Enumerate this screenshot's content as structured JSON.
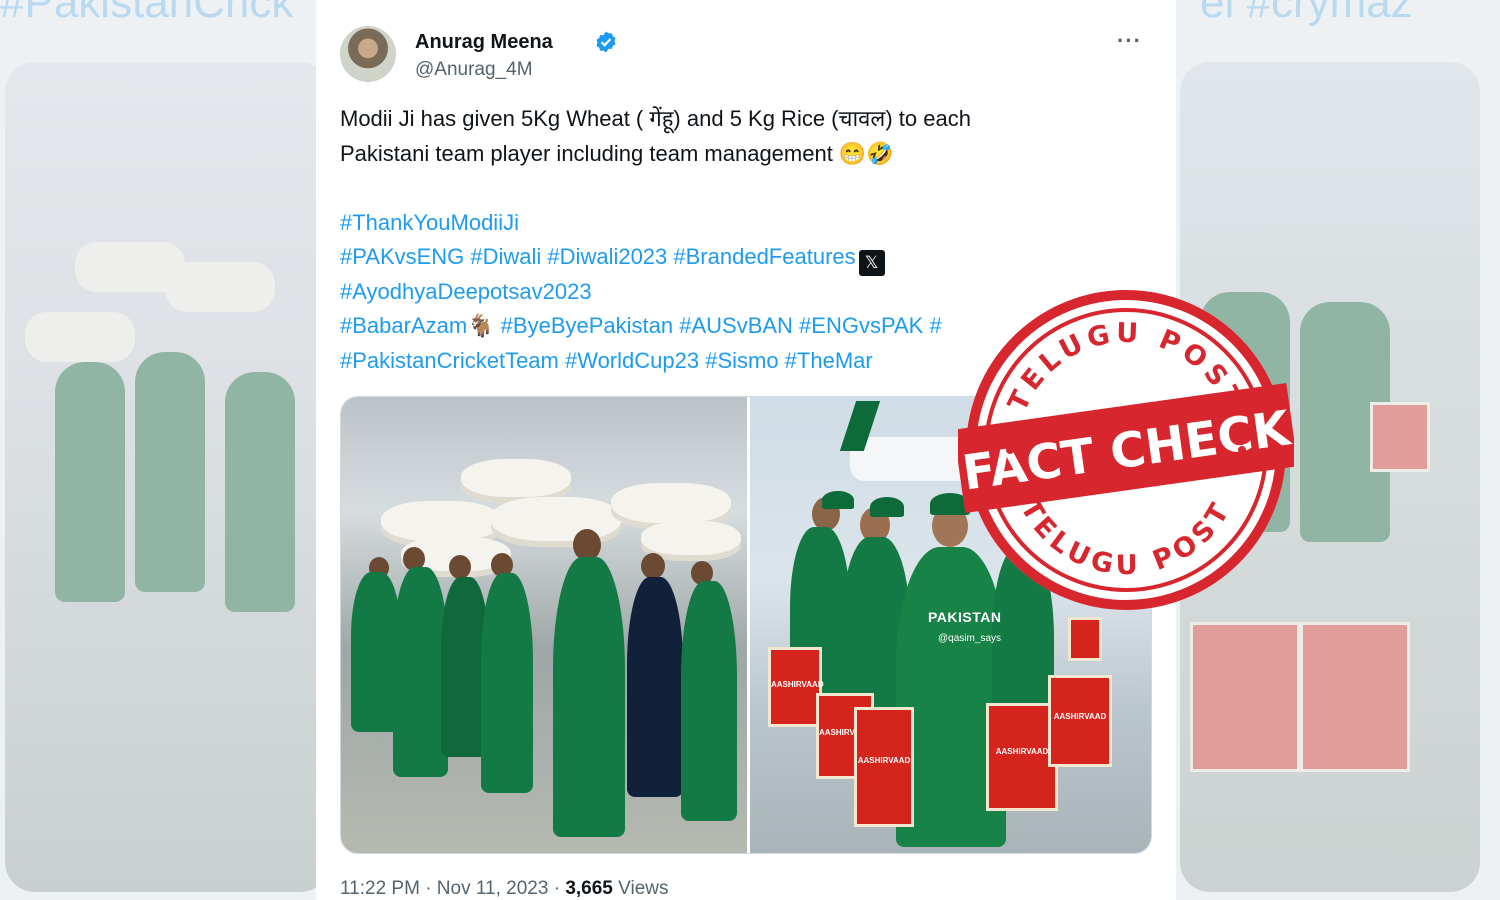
{
  "background": {
    "left_hashtag": "#PakistanCrick",
    "right_hashtag": "el #crymaz"
  },
  "tweet": {
    "author_name": "Anurag Meena",
    "author_handle": "@Anurag_4M",
    "verified": true,
    "more_label": "···",
    "lines": [
      "Modii Ji has given 5Kg Wheat ( गेंहू) and 5 Kg Rice (चावल) to each",
      "Pakistani team player including team management  😁🤣"
    ],
    "hashtag_line_1": "#ThankYouModiiJi",
    "hashtag_line_2": "#PAKvsENG #Diwali #Diwali2023 #BrandedFeatures",
    "x_glyph": "𝕏",
    "hashtag_line_3": "#AyodhyaDeepotsav2023",
    "hashtag_line_4": "#BabarAzam🐐 #ByeByePakistan #AUSvBAN  #ENGvsPAK #",
    "hashtag_line_5": "#PakistanCricketTeam  #WorldCup23  #Sismo  #TheMar",
    "image_2_jersey": "PAKISTAN",
    "image_2_watermark": "@qasim_says",
    "timestamp": "11:22 PM · Nov 11, 2023 · ",
    "views_count": "3,665",
    "views_label": " Views"
  },
  "stamp": {
    "top_text": "TELUGU POST",
    "bottom_text": "TELUGU POST",
    "banner": "FACT CHECK",
    "color": "#d7262e"
  }
}
